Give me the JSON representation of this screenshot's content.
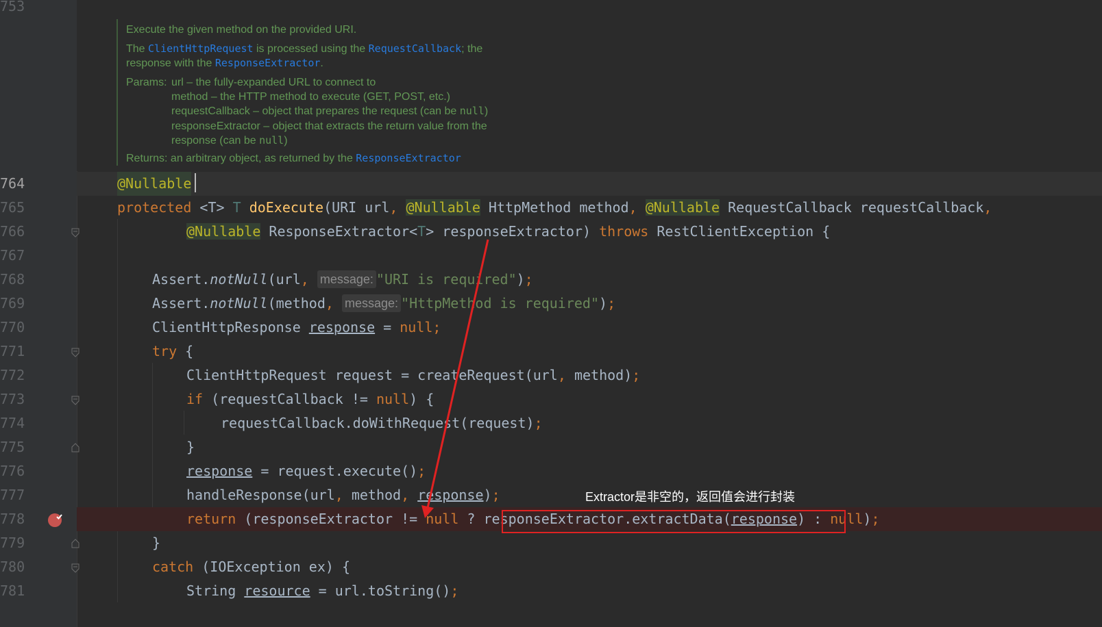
{
  "gutter": {
    "line_numbers": [
      "753",
      "764",
      "765",
      "766",
      "767",
      "768",
      "769",
      "770",
      "771",
      "772",
      "773",
      "774",
      "775",
      "776",
      "777",
      "778",
      "779",
      "780",
      "781"
    ]
  },
  "doc": {
    "summary": "Execute the given method on the provided URI.",
    "p2_a": "The ",
    "p2_code1": "ClientHttpRequest",
    "p2_b": " is processed using the ",
    "p2_code2": "RequestCallback",
    "p2_c": "; the",
    "p2_d": "response with the ",
    "p2_code3": "ResponseExtractor",
    "p2_e": ".",
    "params_label": "Params:",
    "param_url": "url – the fully-expanded URL to connect to",
    "param_method": "method – the HTTP method to execute (GET, POST, etc.)",
    "param_cb_a": "requestCallback – object that prepares the request (can be ",
    "param_cb_null": "null",
    "param_cb_b": ")",
    "param_ex": "responseExtractor – object that extracts the return value from the",
    "param_ex2_a": "response (can be ",
    "param_ex2_null": "null",
    "param_ex2_b": ")",
    "returns_a": "Returns: an arbitrary object, as returned by the ",
    "returns_code": "ResponseExtractor"
  },
  "code": {
    "l764_ann": "@Nullable",
    "l765_protected": "protected",
    "l765_gen": " <T> ",
    "l765_T": "T",
    "l765_fn": "doExecute",
    "l765_a": "(URI url",
    "comma": ",",
    "l765_ann1": "@Nullable",
    "l765_b": " HttpMethod method",
    "l765_ann2": "@Nullable",
    "l765_c": " RequestCallback requestCallback",
    "l766_ann": "@Nullable",
    "l766_a": " ResponseExtractor<",
    "l766_T": "T",
    "l766_b": "> responseExtractor) ",
    "l766_throws": "throws",
    "l766_c": " RestClientException {",
    "l768_a": "Assert.",
    "l768_fn": "notNull",
    "l768_b": "(url",
    "l768_hint": "message:",
    "l768_str": "\"URI is required\"",
    "l768_c": ")",
    "semi": ";",
    "l769_a": "Assert.",
    "l769_fn": "notNull",
    "l769_b": "(method",
    "l769_hint": "message:",
    "l769_str": "\"HttpMethod is required\"",
    "l769_c": ")",
    "l770_a": "ClientHttpResponse ",
    "l770_var": "response",
    "l770_b": " = ",
    "l770_null": "null",
    "l771_try": "try",
    "l771_a": " {",
    "l772_a": "ClientHttpRequest request = createRequest(url",
    "l772_b": " method)",
    "l773_if": "if",
    "l773_a": " (requestCallback != ",
    "l773_null": "null",
    "l773_b": ") {",
    "l774_a": "requestCallback.doWithRequest(request)",
    "l775_a": "}",
    "l776_var": "response",
    "l776_a": " = request.execute()",
    "l777_a": "handleResponse(url",
    "l777_b": " method",
    "l777_var": "response",
    "l777_c": ")",
    "l778_return": "return",
    "l778_a": " (responseExtractor != ",
    "l778_null1": "null",
    "l778_b": " ? responseExtractor.extractData(",
    "l778_var": "response",
    "l778_c": ") : ",
    "l778_null2": "null",
    "l778_d": ")",
    "l779_a": "}",
    "l780_catch": "catch",
    "l780_a": " (IOException ex) {",
    "l781_a": "String ",
    "l781_var": "resource",
    "l781_b": " = url.toString()"
  },
  "annotation": {
    "text": "Extractor是非空的，返回值会进行封装",
    "color": "#e02222"
  },
  "colors": {
    "background": "#2b2b2b",
    "keyword": "#cc7832",
    "annotation": "#bbb529",
    "string": "#6a8759",
    "doc_comment": "#629755",
    "function": "#ffc66d"
  }
}
